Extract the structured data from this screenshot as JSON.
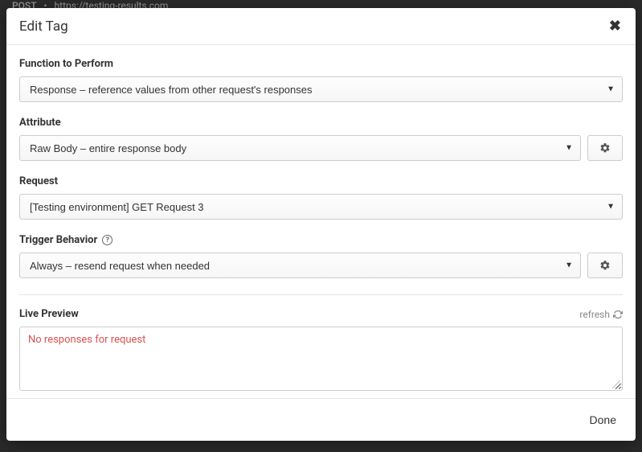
{
  "background": {
    "method": "POST",
    "dot": "•",
    "url": "https://testing-results.com"
  },
  "modal": {
    "title": "Edit Tag",
    "fields": {
      "function": {
        "label": "Function to Perform",
        "value": "Response – reference values from other request's responses"
      },
      "attribute": {
        "label": "Attribute",
        "value": "Raw Body – entire response body"
      },
      "request": {
        "label": "Request",
        "value": "[Testing environment] GET Request 3"
      },
      "trigger": {
        "label": "Trigger Behavior",
        "value": "Always – resend request when needed"
      }
    },
    "preview": {
      "label": "Live Preview",
      "refresh": "refresh",
      "content": "No responses for request"
    },
    "done": "Done"
  }
}
